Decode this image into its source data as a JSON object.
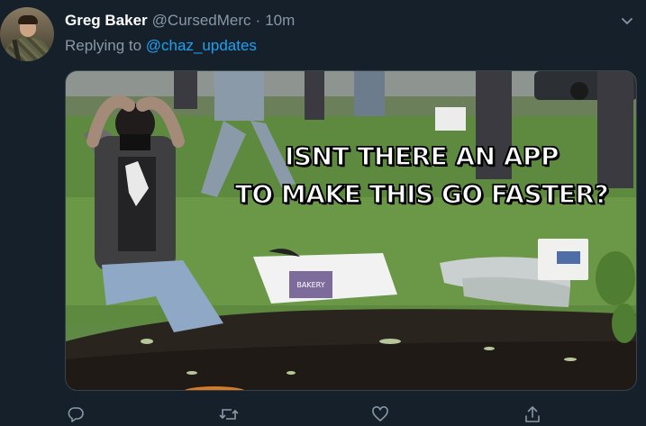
{
  "tweet": {
    "author": {
      "display_name": "Greg Baker",
      "handle": "@CursedMerc",
      "separator": "·",
      "time": "10m"
    },
    "reply": {
      "prefix": "Replying to",
      "target": "@chaz_updates"
    },
    "media": {
      "caption_line1": "ISNT THERE AN APP",
      "caption_line2": "TO MAKE THIS GO FASTER?",
      "box_text": "BAKERY"
    },
    "actions": [
      "reply-icon",
      "retweet-icon",
      "like-icon",
      "share-icon"
    ]
  },
  "colors": {
    "background": "#15202b",
    "muted_text": "#8899a6",
    "link": "#1da1f2",
    "border": "#38444d"
  }
}
